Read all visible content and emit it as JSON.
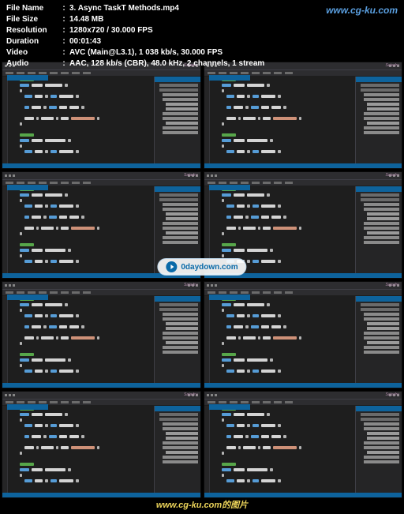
{
  "info": {
    "file_name_label": "File Name",
    "file_name": "3. Async TaskT Methods.mp4",
    "file_size_label": "File Size",
    "file_size": "14.48 MB",
    "resolution_label": "Resolution",
    "resolution": "1280x720 / 30.000 FPS",
    "duration_label": "Duration",
    "duration": "00:01:43",
    "video_label": "Video",
    "video": "AVC (Main@L3.1), 1 038 kb/s, 30.000 FPS",
    "audio_label": "Audio",
    "audio": "AAC, 128 kb/s (CBR), 48.0 kHz, 2 channels, 1 stream",
    "sep": ":"
  },
  "watermark_top": "www.cg-ku.com",
  "watermark_bottom": "www.cg-ku.com的图片",
  "center_badge": "0daydown.com",
  "ide": {
    "brand": "Satadru",
    "tab": "MathHelper.cs",
    "statusbar_text": "Ready",
    "solution_explorer_title": "Solution Explorer",
    "code_tokens": {
      "attr": "[Test]",
      "method1": "public async Task Test_Add()",
      "line1a": "SampleClass sut = new SampleClass();",
      "line1b": "int result = await sut.Add(2, 4);",
      "line1c": "Assert.That(result, Is.EqualTo(6), \"Result is wrong\");",
      "method2": "public async Task Test_Subtract()"
    }
  }
}
